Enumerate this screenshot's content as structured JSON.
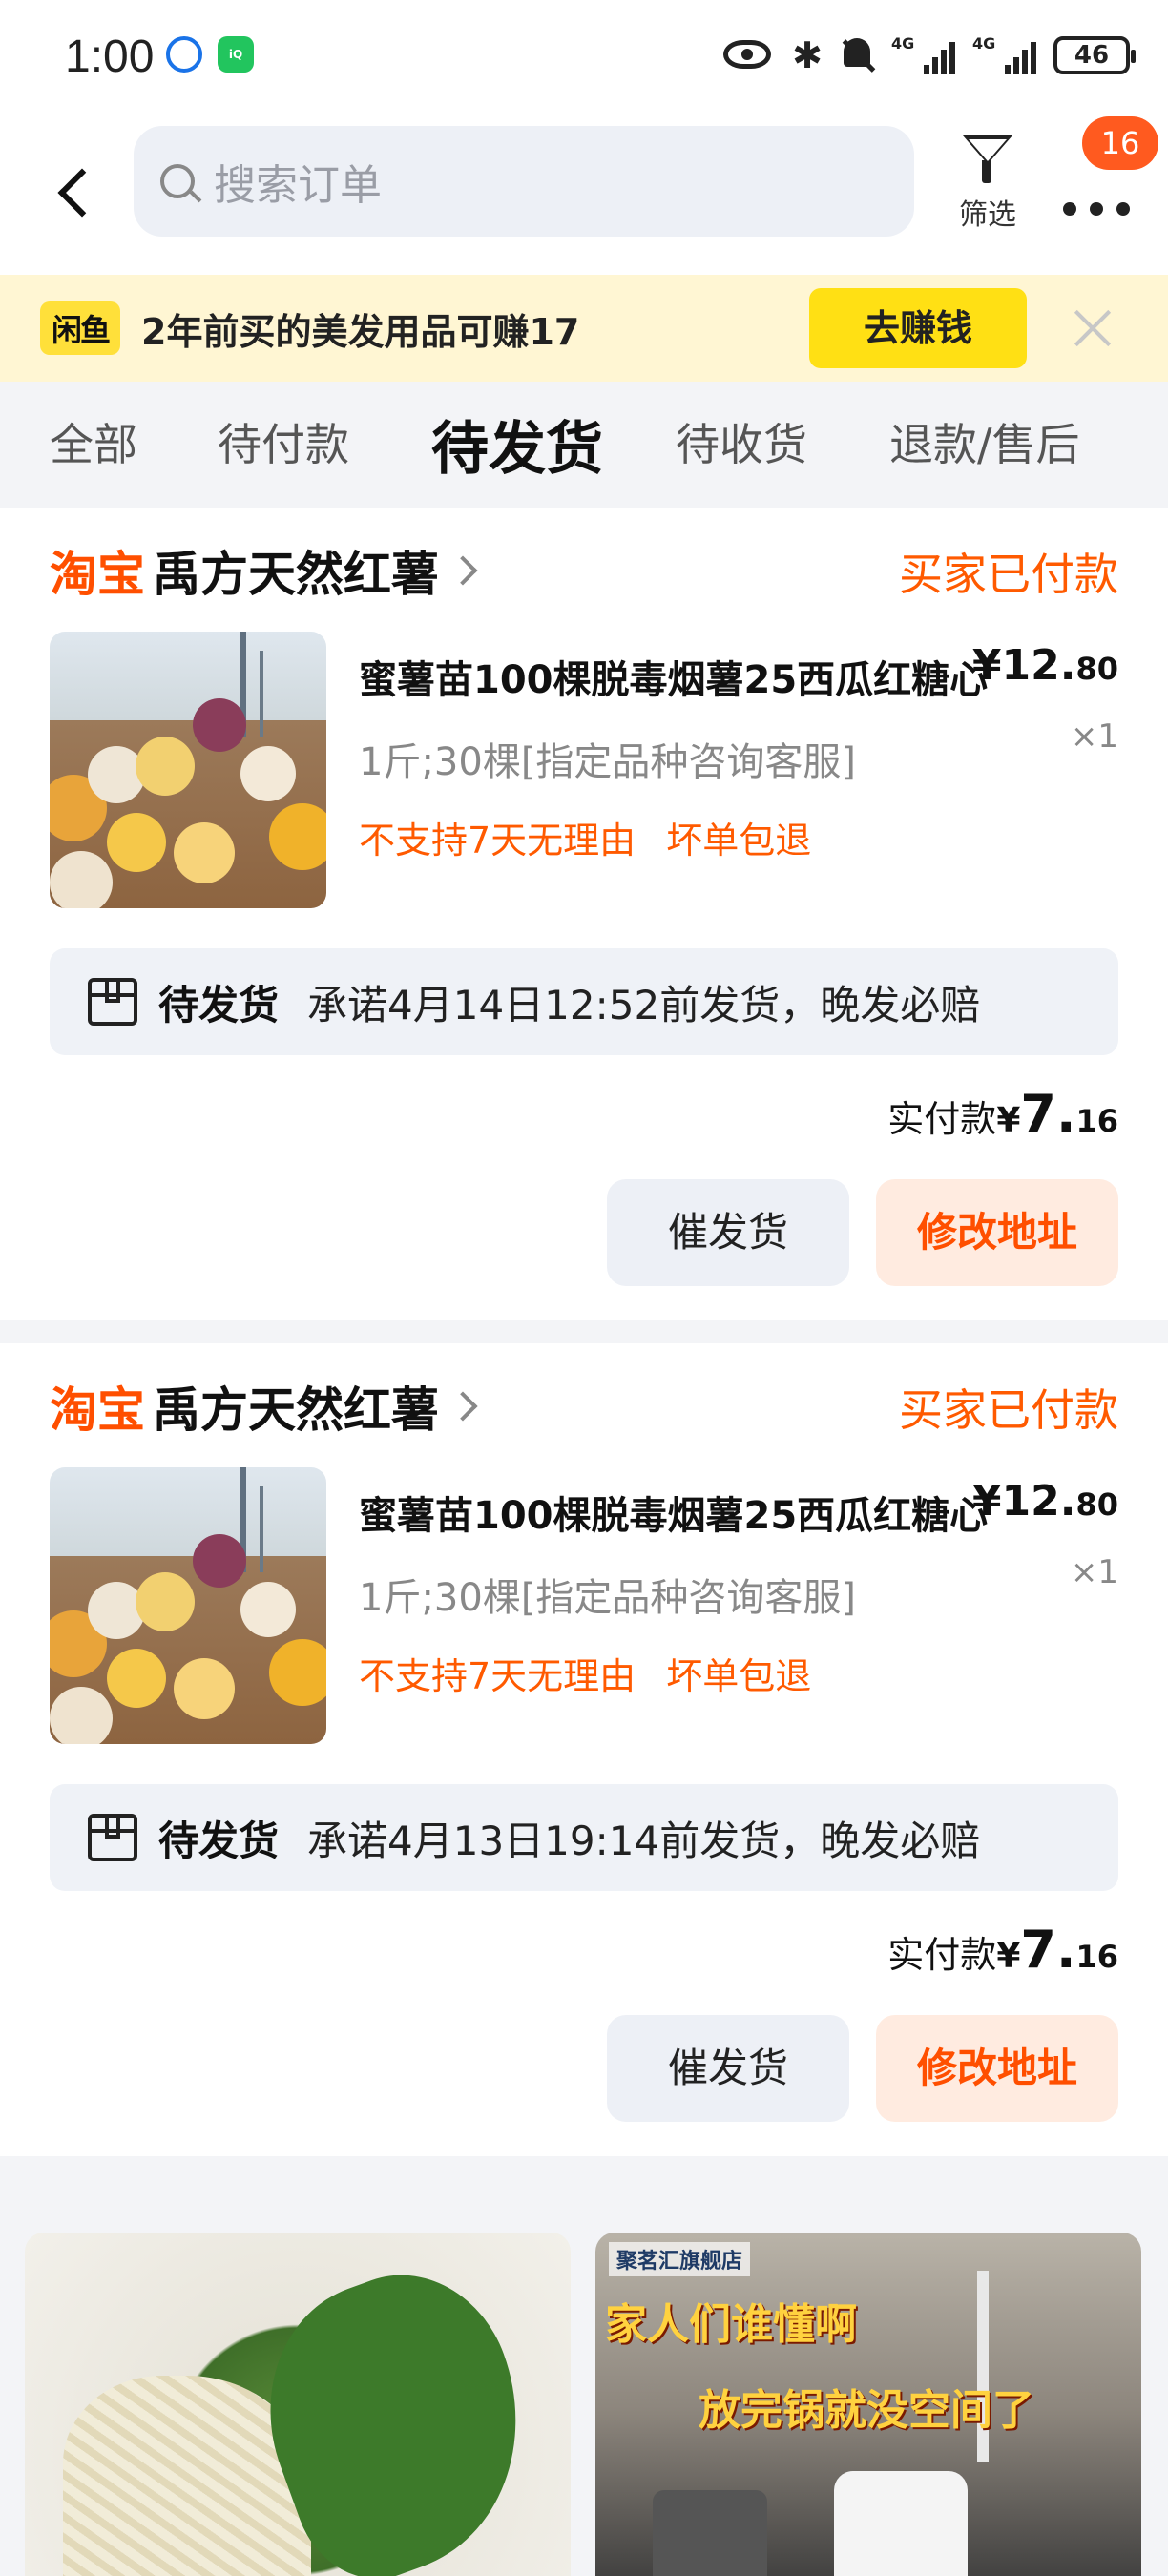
{
  "status_bar": {
    "time": "1:00",
    "battery": "46",
    "signal1_label": "4G",
    "signal2_label": "4G"
  },
  "header": {
    "search_placeholder": "搜索订单",
    "filter_label": "筛选",
    "more_badge": "16"
  },
  "promo": {
    "logo": "闲鱼",
    "text": "2年前买的美发用品可赚17",
    "button": "去赚钱"
  },
  "tabs": [
    {
      "label": "全部",
      "active": false
    },
    {
      "label": "待付款",
      "active": false
    },
    {
      "label": "待发货",
      "active": true
    },
    {
      "label": "待收货",
      "active": false
    },
    {
      "label": "退款/售后",
      "active": false
    }
  ],
  "orders": [
    {
      "platform": "淘宝",
      "shop": "禹方天然红薯",
      "status": "买家已付款",
      "title": "蜜薯苗100棵脱毒烟薯25西瓜红糖心",
      "price_int": "¥12.",
      "price_dec": "80",
      "qty": "×1",
      "spec": "1斤;30棵[指定品种咨询客服]",
      "tags": [
        "不支持7天无理由",
        "坏单包退"
      ],
      "ship_label": "待发货",
      "ship_text": "承诺4月14日12:52前发货，晚发必赔",
      "paid_label": "实付款",
      "paid_cur": "¥",
      "paid_int": "7.",
      "paid_dec": "16",
      "btn_urge": "催发货",
      "btn_addr": "修改地址"
    },
    {
      "platform": "淘宝",
      "shop": "禹方天然红薯",
      "status": "买家已付款",
      "title": "蜜薯苗100棵脱毒烟薯25西瓜红糖心",
      "price_int": "¥12.",
      "price_dec": "80",
      "qty": "×1",
      "spec": "1斤;30棵[指定品种咨询客服]",
      "tags": [
        "不支持7天无理由",
        "坏单包退"
      ],
      "ship_label": "待发货",
      "ship_text": "承诺4月13日19:14前发货，晚发必赔",
      "paid_label": "实付款",
      "paid_cur": "¥",
      "paid_int": "7.",
      "paid_dec": "16",
      "btn_urge": "催发货",
      "btn_addr": "修改地址"
    }
  ],
  "feed": {
    "right_store": "聚茗汇旗舰店",
    "right_caption1": "家人们谁懂啊",
    "right_caption2": "放完锅就没空间了"
  },
  "colors": {
    "accent_orange": "#ff5a00",
    "promo_bg": "#fff6d3",
    "promo_button": "#ffe014"
  }
}
